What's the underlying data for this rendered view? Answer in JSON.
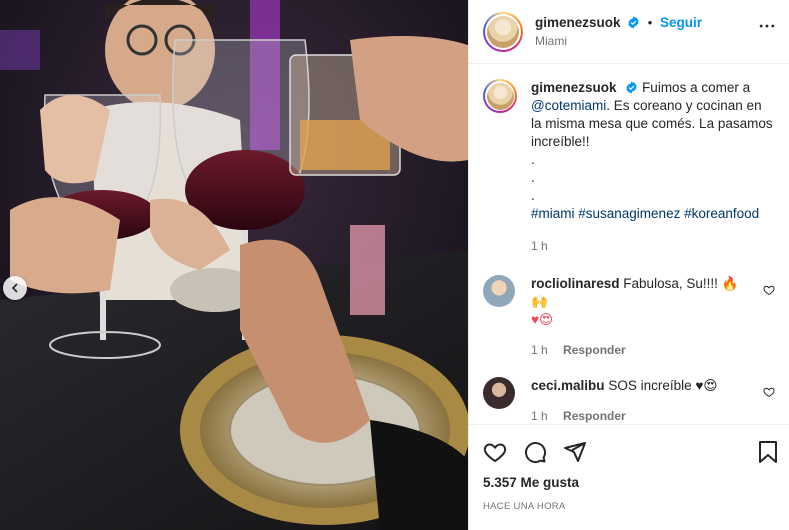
{
  "post": {
    "username": "gimenezsuok",
    "follow_label": "Seguir",
    "location": "Miami",
    "more_icon": "more-horizontal-icon"
  },
  "caption": {
    "username": "gimenezsuok",
    "text_1": "Fuimos a comer a",
    "mention": "@cotemiami",
    "text_2": ". Es coreano y cocinan en la misma mesa que comés. La pasamos increíble!!",
    "dot_1": ".",
    "dot_2": ".",
    "dot_3": ".",
    "hashtags": "#miami #susanagimenez #koreanfood",
    "time": "1 h"
  },
  "comments": [
    {
      "username": "rocliolinaresd",
      "text": "Fabulosa, Su!!!! 🔥🙌",
      "second_line": "♥😍",
      "time": "1 h",
      "reply_label": "Responder"
    },
    {
      "username": "ceci.malibu",
      "text": "SOS increíble ♥😍",
      "time": "1 h",
      "reply_label": "Responder"
    }
  ],
  "footer": {
    "likes": "5.357 Me gusta",
    "timestamp": "Hace una hora"
  },
  "colors": {
    "accent": "#0095f6",
    "text": "#262626",
    "muted": "#737373",
    "link": "#00376b",
    "heart": "#ed4956"
  }
}
